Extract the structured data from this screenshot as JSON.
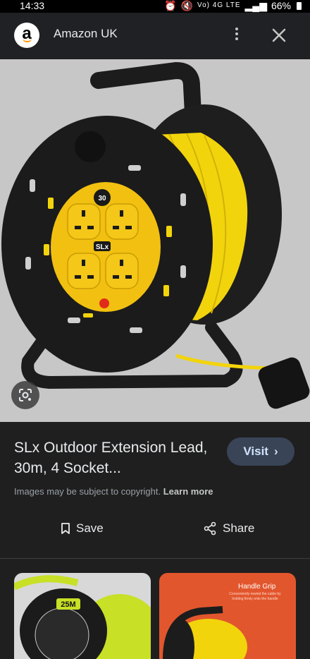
{
  "status_bar": {
    "time": "14:33",
    "network": "Vo) 4G LTE",
    "battery": "66%"
  },
  "header": {
    "favicon_letter": "a",
    "site_name": "Amazon UK"
  },
  "image": {
    "reel_label": "30",
    "brand": "SLx"
  },
  "result": {
    "title": "SLx Outdoor Extension Lead, 30m, 4 Socket...",
    "visit_label": "Visit",
    "copyright_text": "Images may be subject to copyright.",
    "learn_more": "Learn more",
    "save_label": "Save",
    "share_label": "Share"
  },
  "related": [
    {
      "badge": "25M"
    },
    {
      "caption": "Handle Grip",
      "subtext": "Conveniently rewind the cable by holding firmly onto the handle"
    }
  ],
  "colors": {
    "background": "#1f1f1f",
    "image_bg": "#c7c7c7",
    "reel_yellow": "#f5d90a",
    "visit_bg": "#394457",
    "thumb2_bg": "#e2562d"
  }
}
